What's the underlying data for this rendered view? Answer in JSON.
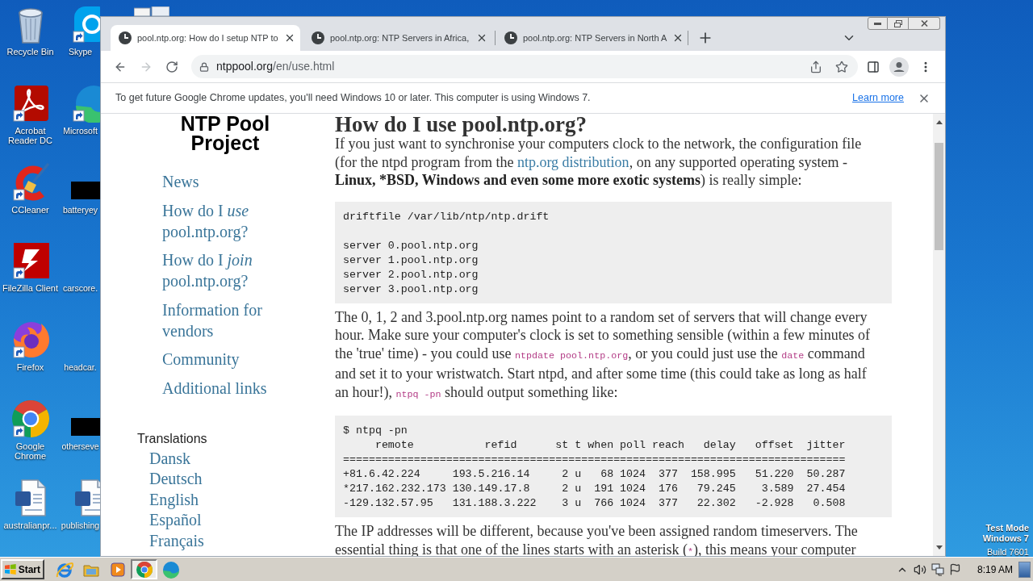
{
  "desktop": {
    "columns": [
      [
        {
          "kind": "recycle_bin",
          "label": "Recycle Bin",
          "shortcut": false
        },
        {
          "kind": "acrobat",
          "label": "Acrobat Reader DC",
          "shortcut": true
        },
        {
          "kind": "ccleaner",
          "label": "CCleaner",
          "shortcut": true
        },
        {
          "kind": "filezilla",
          "label": "FileZilla Client",
          "shortcut": true
        },
        {
          "kind": "firefox",
          "label": "Firefox",
          "shortcut": true
        },
        {
          "kind": "chrome",
          "label": "Google Chrome",
          "shortcut": true
        },
        {
          "kind": "word",
          "label": "australianpr...",
          "shortcut": false
        }
      ],
      [
        {
          "kind": "skype",
          "label": "Skype",
          "shortcut": true
        },
        {
          "kind": "edge",
          "label": "Microsoft",
          "shortcut": true
        },
        {
          "kind": "redacted",
          "label": "batteryey"
        },
        {
          "kind": "blank",
          "label": "carscore."
        },
        {
          "kind": "blank",
          "label": "headcar."
        },
        {
          "kind": "redacted",
          "label": "otherseve"
        },
        {
          "kind": "word",
          "label": "publishing",
          "shortcut": false
        }
      ]
    ],
    "system_note": [
      "Test Mode",
      "Windows 7",
      "Build 7601"
    ]
  },
  "browser": {
    "tabs": [
      {
        "title": "pool.ntp.org: How do I setup NTP to",
        "selected": true
      },
      {
        "title": "pool.ntp.org: NTP Servers in Africa,",
        "selected": false
      },
      {
        "title": "pool.ntp.org: NTP Servers in North A",
        "selected": false
      }
    ],
    "nav_buttons": [
      {
        "kind": "back",
        "disabled": false
      },
      {
        "kind": "forward",
        "disabled": true
      },
      {
        "kind": "reload",
        "disabled": false
      }
    ],
    "address": {
      "host": "ntppool.org",
      "path": "/en/use.html"
    },
    "infobar": {
      "message": "To get future Google Chrome updates, you'll need Windows 10 or later. This computer is using Windows 7.",
      "link": "Learn more"
    },
    "page": {
      "logo": "NTP Pool Project",
      "nav": [
        "News",
        "How do I *use* pool.ntp.org?",
        "How do I *join* pool.ntp.org?",
        "Information for vendors",
        "Community",
        "Additional links"
      ],
      "translations": {
        "title": "Translations",
        "languages": [
          "Dansk",
          "Deutsch",
          "English",
          "Español",
          "Français"
        ]
      },
      "content": [
        {
          "kind": "heading",
          "text": "How do I use pool.ntp.org?"
        },
        {
          "kind": "paragraph",
          "parts": [
            {
              "kind": "text",
              "text": "If you just want to synchronise your computers clock to the network, the configuration file (for the ntpd program from the "
            },
            {
              "kind": "link",
              "text": "ntp.org distribution"
            },
            {
              "kind": "text",
              "text": ", on any supported operating system - "
            },
            {
              "kind": "bold",
              "text": "Linux, *BSD, Windows and even some more exotic systems"
            },
            {
              "kind": "text",
              "text": ") is really simple:"
            }
          ]
        },
        {
          "kind": "code",
          "text": "driftfile /var/lib/ntp/ntp.drift\n\nserver 0.pool.ntp.org\nserver 1.pool.ntp.org\nserver 2.pool.ntp.org\nserver 3.pool.ntp.org"
        },
        {
          "kind": "paragraph",
          "parts": [
            {
              "kind": "text",
              "text": "The 0, 1, 2 and 3.pool.ntp.org names point to a random set of servers that will change every hour. Make sure your computer's clock is set to something sensible (within a few minutes of the 'true' time) - you could use "
            },
            {
              "kind": "code",
              "text": "ntpdate pool.ntp.org"
            },
            {
              "kind": "text",
              "text": ", or you could just use the "
            },
            {
              "kind": "code",
              "text": "date"
            },
            {
              "kind": "text",
              "text": " command and set it to your wristwatch. Start ntpd, and after some time (this could take as long as half an hour!), "
            },
            {
              "kind": "code",
              "text": "ntpq -pn"
            },
            {
              "kind": "text",
              "text": " should output something like:"
            }
          ]
        },
        {
          "kind": "code",
          "text": "$ ntpq -pn\n     remote           refid      st t when poll reach   delay   offset  jitter\n==============================================================================\n+81.6.42.224     193.5.216.14     2 u   68 1024  377  158.995   51.220  50.287\n*217.162.232.173 130.149.17.8     2 u  191 1024  176   79.245    3.589  27.454\n-129.132.57.95   131.188.3.222    3 u  766 1024  377   22.302   -2.928   0.508"
        },
        {
          "kind": "paragraph",
          "parts": [
            {
              "kind": "text",
              "text": "The IP addresses will be different, because you've been assigned random timeservers. The essential thing is that one of the lines starts with an asterisk ("
            },
            {
              "kind": "code",
              "text": "*"
            },
            {
              "kind": "text",
              "text": "), this means your computer"
            }
          ]
        }
      ]
    }
  },
  "taskbar": {
    "start": "Start",
    "apps": [
      {
        "kind": "ie",
        "active": false
      },
      {
        "kind": "explorer",
        "active": false
      },
      {
        "kind": "media_player",
        "active": false
      },
      {
        "kind": "chrome",
        "active": true
      },
      {
        "kind": "edge",
        "active": false
      }
    ],
    "clock": "8:19 AM"
  }
}
